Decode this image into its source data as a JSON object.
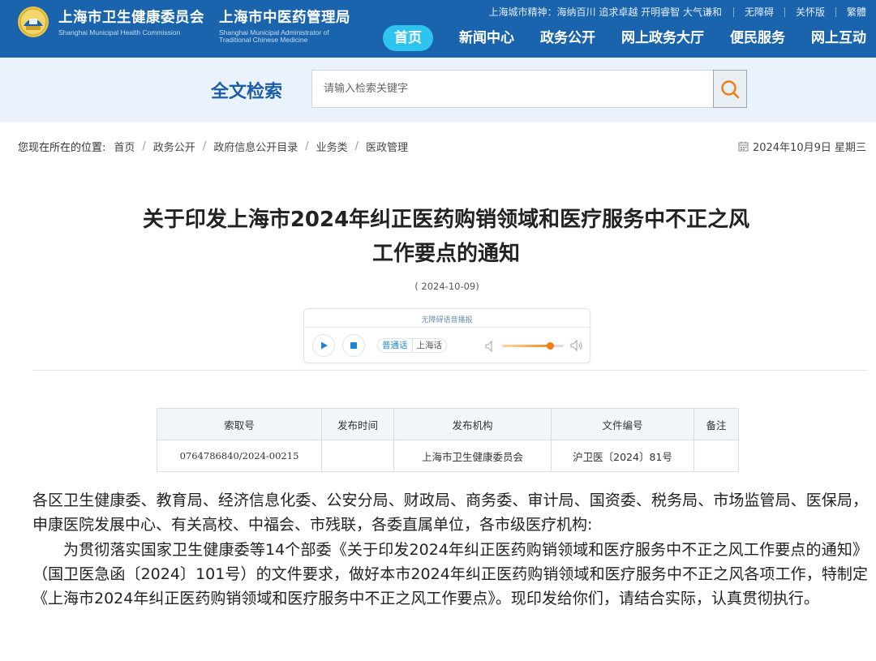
{
  "header": {
    "org1_cn": "上海市卫生健康委员会",
    "org1_en": "Shanghai Municipal Health Commission",
    "org2_cn": "上海市中医药管理局",
    "org2_en_line1": "Shanghai Municipal Administrator of",
    "org2_en_line2": "Traditional Chinese Medicine",
    "city_spirit": "上海城市精神：海纳百川 追求卓越 开明睿智 大气谦和",
    "links": [
      "无障碍",
      "关怀版",
      "繁體"
    ],
    "nav": [
      "首页",
      "新闻中心",
      "政务公开",
      "网上政务大厅",
      "便民服务",
      "网上互动"
    ],
    "brand_color": "#1a64ae",
    "active_nav_color": "#2ec4ee"
  },
  "search": {
    "title": "全文检索",
    "placeholder": "请输入检索关键字",
    "button_icon": "search-icon",
    "accent_color": "#f07c14"
  },
  "breadcrumb": {
    "lead": "您现在所在的位置:",
    "items": [
      "首页",
      "政务公开",
      "政府信息公开目录",
      "业务类",
      "医政管理"
    ],
    "date": "2024年10月9日 星期三"
  },
  "article": {
    "title_line1": "关于印发上海市2024年纠正医药购销领域和医疗服务中不正之风",
    "title_line2": "工作要点的通知",
    "date": "( 2024-10-09)",
    "player": {
      "label": "无障碍语音播报",
      "lang_on": "普通话",
      "lang_off": "上海话",
      "volume_level": 0.78
    },
    "meta_headers": [
      "索取号",
      "发布时间",
      "发布机构",
      "文件编号",
      "备注"
    ],
    "meta_values": [
      "0764786840/2024-00215",
      "",
      "上海市卫生健康委员会",
      "沪卫医〔2024〕81号",
      ""
    ],
    "recipients": "各区卫生健康委、教育局、经济信息化委、公安分局、财政局、商务委、审计局、国资委、税务局、市场监管局、医保局，申康医院发展中心、有关高校、中福会、市残联，各委直属单位，各市级医疗机构:",
    "paragraph1": "为贯彻落实国家卫生健康委等14个部委《关于印发2024年纠正医药购销领域和医疗服务中不正之风工作要点的通知》（国卫医急函〔2024〕101号）的文件要求，做好本市2024年纠正医药购销领域和医疗服务中不正之风各项工作，特制定《上海市2024年纠正医药购销领域和医疗服务中不正之风工作要点》。现印发给你们，请结合实际，认真贯彻执行。"
  }
}
